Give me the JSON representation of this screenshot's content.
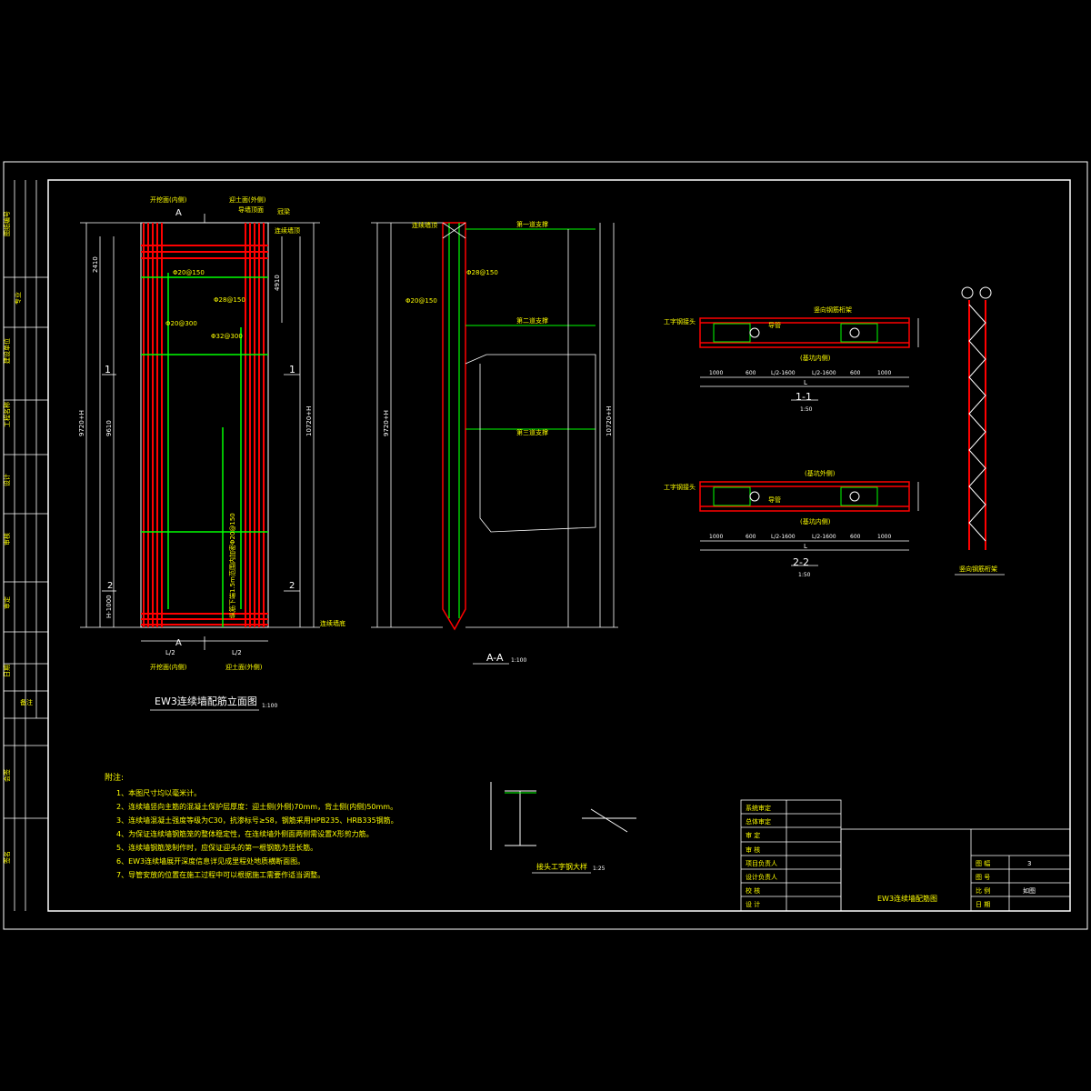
{
  "sheet": {
    "title_main": "EW3连续墙配筋立面图",
    "title_main_scale": "1:100",
    "section_aa": "A-A",
    "section_aa_scale": "1:100",
    "section_11": "1-1",
    "section_11_scale": "1:50",
    "section_22": "2-2",
    "section_22_scale": "1:50",
    "vertical_truss": "竖向钢筋桁架",
    "joint_detail": "接头工字钢大样",
    "joint_detail_scale": "1:25"
  },
  "elevation_labels": {
    "digging_face": "开挖面(内侧)",
    "soil_face": "迎土面(外侧)",
    "cap_beam": "冠梁",
    "guide_wall": "导墙顶面",
    "wall_bottom": "连续墙底",
    "wall_top": "连续墙顶",
    "mark_a": "A",
    "mark_1": "1",
    "mark_2": "2",
    "half_l": "L/2",
    "dim_1": "9720+H",
    "dim_2": "10720+H",
    "dim_3": "9610",
    "dim_4": "4910",
    "dim_5": "2410",
    "dim_6": "H-1000",
    "rebar_1": "Φ20@150",
    "rebar_2": "Φ20@300",
    "rebar_3": "Φ28@150",
    "rebar_4": "Φ32@300",
    "rebar_note": "纵筋下端1.5m范围内加密Φ20@150"
  },
  "section_labels": {
    "first_support": "第一道支撑",
    "second_support": "第二道支撑",
    "third_support": "第三道支撑",
    "guide_pipe": "导管",
    "inner_side": "(基坑内侧)",
    "outer_side": "(基坑外侧)",
    "truss_label": "竖向钢筋桁架",
    "i_beam": "工字钢接头",
    "dims": [
      "1000",
      "600",
      "L/2-1600",
      "L/2-1600",
      "600",
      "1000"
    ],
    "total": "L"
  },
  "notes": {
    "header": "附注:",
    "items": [
      "1、本图尺寸均以毫米计。",
      "2、连续墙竖向主筋的混凝土保护层厚度：迎土侧(外侧)70mm，背土侧(内侧)50mm。",
      "3、连续墙混凝土强度等级为C30，抗渗标号≥S8，钢筋采用HPB235、HRB335钢筋。",
      "4、为保证连续墙钢筋笼的整体稳定性，在连续墙外侧面两侧需设置X形剪力筋。",
      "5、连续墙钢筋笼制作时，应保证迎头的第一根钢筋为竖长筋。",
      "6、EW3连续墙展开深度信息详见成里程处地质横断面图。",
      "7、导管安放的位置在施工过程中可以根据施工需要作适当调整。"
    ]
  },
  "left_strip": [
    "图纸编号",
    "专业",
    "建设单位",
    "工程名称",
    "设计",
    "审核",
    "审定",
    "日期",
    "备注",
    "会签",
    "签名"
  ],
  "title_block": {
    "rows_left": [
      "系统审定",
      "总体审定",
      "审 定",
      "审 核",
      "项目负责人",
      "设计负责人",
      "校 核",
      "设 计"
    ],
    "drawing_name": "EW3连续墙配筋图",
    "right_labels": [
      "图 幅",
      "图 号",
      "比 例",
      "日 期"
    ],
    "right_values": [
      "3",
      "",
      "如图",
      ""
    ]
  },
  "colors": {
    "background": "#000000",
    "frame": "#ffffff",
    "rebar_main": "#ff0000",
    "rebar_secondary": "#00ff00",
    "text_label": "#ffff00",
    "dimension": "#ffffff"
  }
}
